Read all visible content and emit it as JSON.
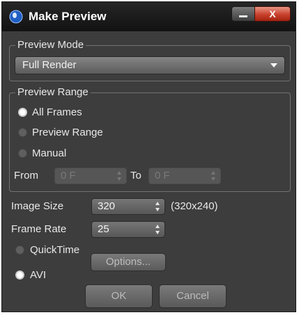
{
  "window": {
    "title": "Make Preview",
    "close_glyph": "X"
  },
  "preview_mode": {
    "legend": "Preview Mode",
    "selected": "Full Render"
  },
  "preview_range": {
    "legend": "Preview Range",
    "options": [
      "All Frames",
      "Preview Range",
      "Manual"
    ],
    "selected_index": 0,
    "from_label": "From",
    "from_value": "0 F",
    "to_label": "To",
    "to_value": "0 F"
  },
  "image_size": {
    "label": "Image Size",
    "value": "320",
    "dimensions": "(320x240)"
  },
  "frame_rate": {
    "label": "Frame Rate",
    "value": "25"
  },
  "format": {
    "options": [
      "QuickTime",
      "AVI"
    ],
    "selected": "AVI",
    "options_button": "Options..."
  },
  "buttons": {
    "ok": "OK",
    "cancel": "Cancel"
  },
  "colors": {
    "window_bg": "#3d3d3d",
    "titlebar": "#1c1c1c",
    "close_red": "#c8402b"
  },
  "icons": [
    "app-logo-icon",
    "minimize-icon",
    "close-icon",
    "dropdown-arrow-icon",
    "spinner-arrows-icon"
  ]
}
